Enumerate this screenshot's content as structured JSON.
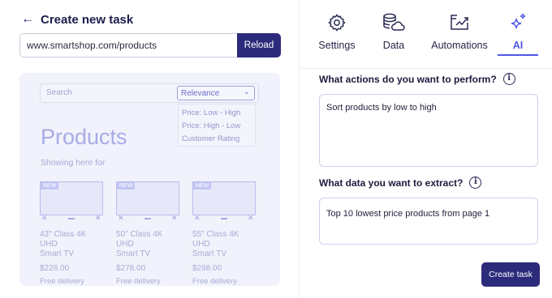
{
  "header": {
    "title": "Create new task"
  },
  "url_bar": {
    "value": "www.smartshop.com/products",
    "reload_label": "Reload"
  },
  "preview": {
    "search_placeholder": "Search",
    "sort_selected": "Relevance",
    "sort_options": [
      "Price: Low - High",
      "Price: High - Low",
      "Customer Rating"
    ],
    "title": "Products",
    "subtitle": "Showing here for",
    "products": [
      {
        "badge": "NEW",
        "name_line1": "43\" Class 4K UHD",
        "name_line2": "Smart TV",
        "price": "$228.00",
        "delivery": "Free delivery"
      },
      {
        "badge": "NEW",
        "name_line1": "50\" Class 4K UHD",
        "name_line2": "Smart TV",
        "price": "$278.00",
        "delivery": "Free delivery"
      },
      {
        "badge": "NEW",
        "name_line1": "55\" Class 4K UHD",
        "name_line2": "Smart TV",
        "price": "$298.00",
        "delivery": "Free delivery"
      }
    ]
  },
  "tabs": [
    {
      "label": "Settings",
      "icon": "gear-icon"
    },
    {
      "label": "Data",
      "icon": "database-icon"
    },
    {
      "label": "Automations",
      "icon": "automations-icon"
    },
    {
      "label": "AI",
      "icon": "sparkle-icon",
      "active": true
    }
  ],
  "actions": {
    "question": "What actions do you want to perform?",
    "value": "Sort products by low to high"
  },
  "extract": {
    "question": "What data you want to extract?",
    "value": "Top 10 lowest price products from page 1"
  },
  "create_label": "Create task",
  "colors": {
    "primary": "#2c2b7b",
    "accent": "#4f57e8",
    "preview_bg": "#f1f2fb"
  }
}
